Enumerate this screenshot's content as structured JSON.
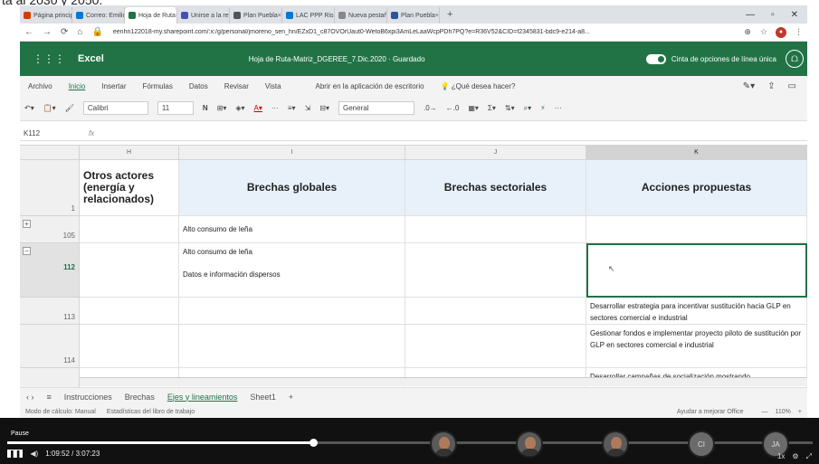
{
  "top_overlay_text": "ta al 2030 y 2050.",
  "browser": {
    "tabs": [
      {
        "label": "Página principal",
        "color": "#d83b01"
      },
      {
        "label": "Correo: Emilio",
        "color": "#0078d4"
      },
      {
        "label": "Hoja de Ruta",
        "color": "#217346"
      },
      {
        "label": "Unirse a la reunión",
        "color": "#464eb8"
      },
      {
        "label": "Plan Puebla",
        "color": "#555555"
      },
      {
        "label": "LAC PPP Risk",
        "color": "#0078d4"
      },
      {
        "label": "Nueva pestaña",
        "color": "#888888"
      },
      {
        "label": "Plan Puebla",
        "color": "#2b579a"
      }
    ],
    "url": "eenhn122018-my.sharepoint.com/:x:/g/personal/jmoreno_sen_hn/EZxD1_c87OVOrUaut0-WetoB6xpi3AmLeLaaWcpPDh7PQ?e=R36V52&CID=f2345831-bdc9-e214-a8..."
  },
  "excel": {
    "app_name": "Excel",
    "doc_title": "Hoja de Ruta-Matriz_DGEREE_7.Dic.2020",
    "saved_state": "Guardado",
    "ribbon_toggle_label": "Cinta de opciones de línea única",
    "menu": [
      "Archivo",
      "Inicio",
      "Insertar",
      "Fórmulas",
      "Datos",
      "Revisar",
      "Vista"
    ],
    "open_desktop": "Abrir en la aplicación de escritorio",
    "tell_me": "¿Qué desea hacer?",
    "font_name": "Calibri",
    "font_size": "11",
    "number_format": "General",
    "name_box": "K112",
    "fx": "fx",
    "columns": [
      "H",
      "I",
      "J",
      "K"
    ],
    "headers": [
      "Otros actores (energía y relacionados)",
      "Brechas globales",
      "Brechas sectoriales",
      "Acciones propuestas"
    ],
    "header_row_num": "1",
    "rows": [
      {
        "num": "105",
        "I": "Alto consumo de leña",
        "K": ""
      },
      {
        "num": "112",
        "I1": "Alto consumo de leña",
        "I2": "Datos e información dispersos",
        "K": ""
      },
      {
        "num": "113",
        "K": "Desarrollar estrategia para incentivar sustitución hacia GLP en sectores comercial e industrial"
      },
      {
        "num": "114",
        "K": "Gestionar fondos e implementar proyecto piloto de sustitución por GLP en sectores comercial e industrial"
      }
    ],
    "partial_row_text": "Desarrollar campañas de socialización mostrando",
    "sheets": [
      "Instrucciones",
      "Brechas",
      "Ejes y lineamientos",
      "Sheet1"
    ],
    "status_left": "Modo de cálculo: Manual",
    "status_stats": "Estadísticas del libro de trabajo",
    "status_help": "Ayudar a mejorar Office",
    "zoom": "110%"
  },
  "video": {
    "pause_label": "Pause",
    "time": "1:09:52 / 3:07:23",
    "progress": 0.38,
    "participants": [
      "",
      "",
      "",
      "CI",
      "JA"
    ],
    "speed": "1x"
  }
}
